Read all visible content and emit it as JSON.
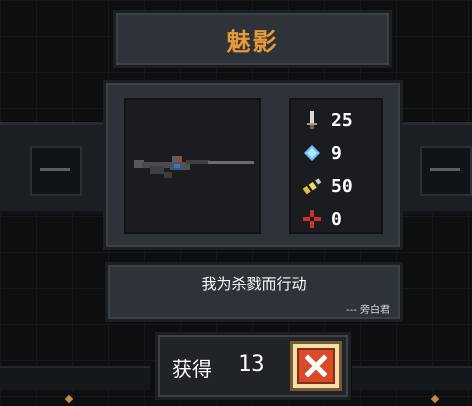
{
  "weapon": {
    "name": "魅影",
    "quote": "我为杀戮而行动",
    "quote_author": "--- 旁白君"
  },
  "stats": [
    {
      "icon": "sword-icon",
      "value": "25"
    },
    {
      "icon": "crystal-icon",
      "value": "9"
    },
    {
      "icon": "bullet-icon",
      "value": "50"
    },
    {
      "icon": "crosshair-icon",
      "value": "0"
    }
  ],
  "obtain": {
    "label": "获得",
    "count": "13"
  },
  "colors": {
    "title": "#e89a3a",
    "panel": "#2d3338",
    "close_button": "#d94a28"
  }
}
